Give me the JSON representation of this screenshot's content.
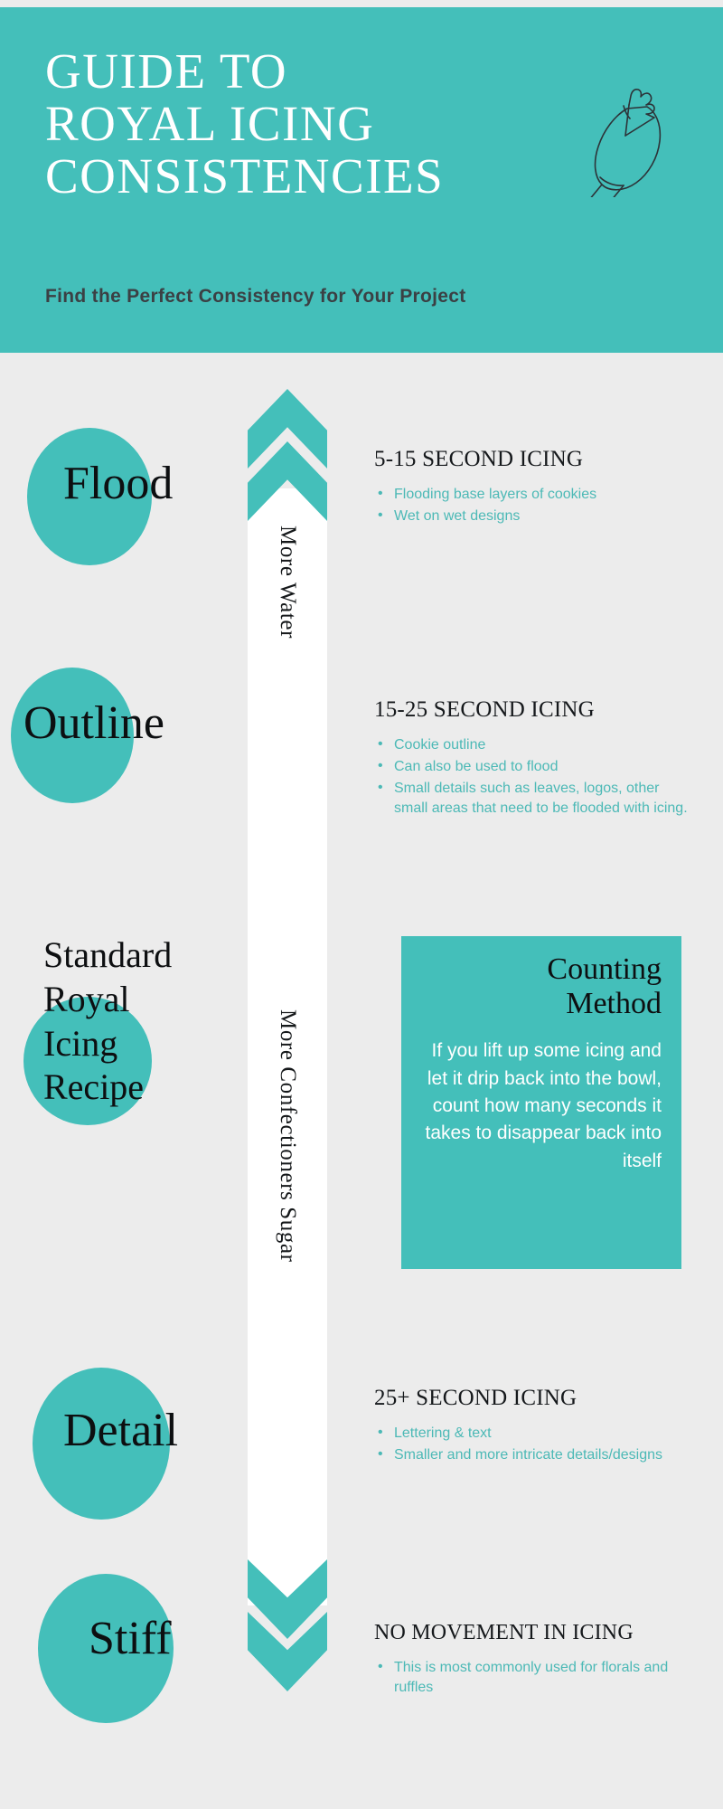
{
  "header": {
    "title_lines": [
      "GUIDE TO",
      "ROYAL ICING",
      "CONSISTENCIES"
    ],
    "subtitle": "Find the Perfect Consistency for Your Project",
    "icon": "piping-bag-icon",
    "background_color": "#44bfba",
    "title_color": "#ffffff",
    "subtitle_color": "#3b4044"
  },
  "page": {
    "background_color": "#ececec",
    "accent_color": "#44bfba",
    "bullet_text_color": "#4cb9b6"
  },
  "arrow": {
    "top_label": "More Water",
    "bottom_label": "More Confectioners Sugar",
    "top_direction": "up",
    "bottom_direction": "down",
    "color": "#44bfba",
    "bar_color": "#ffffff"
  },
  "stages": [
    {
      "name": "Flood",
      "heading": "5-15 SECOND ICING",
      "bullets": [
        "Flooding base layers of cookies",
        "Wet on wet designs"
      ]
    },
    {
      "name": "Outline",
      "heading": "15-25 SECOND ICING",
      "bullets": [
        "Cookie outline",
        "Can also be used to flood",
        "Small details such as leaves, logos, other small areas that need to be flooded with icing."
      ]
    },
    {
      "name": "Detail",
      "heading": "25+ SECOND ICING",
      "bullets": [
        "Lettering & text",
        "Smaller and more intricate details/designs"
      ]
    },
    {
      "name": "Stiff",
      "heading": "NO MOVEMENT IN ICING",
      "bullets": [
        "This is most commonly used for florals and ruffles"
      ]
    }
  ],
  "standard_recipe": {
    "lines": [
      "Standard",
      "Royal",
      "Icing",
      "Recipe"
    ]
  },
  "counting_method": {
    "title_lines": [
      "Counting",
      "Method"
    ],
    "body": "If you lift up some icing and let it drip back into the bowl, count how many seconds it takes to disappear back into itself",
    "background_color": "#44bfba",
    "title_color": "#0d0f11",
    "body_color": "#ffffff"
  }
}
